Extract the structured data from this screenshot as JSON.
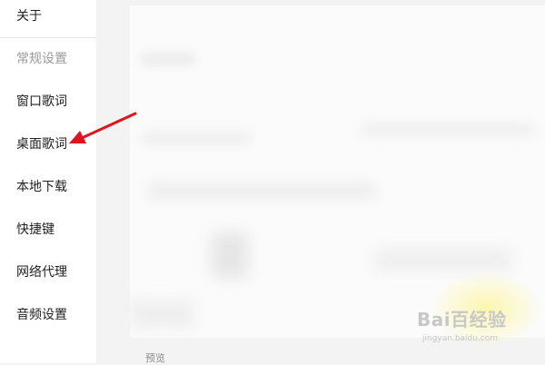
{
  "sidebar": {
    "items": [
      {
        "label": "关于"
      },
      {
        "label": "常规设置"
      },
      {
        "label": "窗口歌词"
      },
      {
        "label": "桌面歌词"
      },
      {
        "label": "本地下载"
      },
      {
        "label": "快捷键"
      },
      {
        "label": "网络代理"
      },
      {
        "label": "音频设置"
      }
    ]
  },
  "main": {
    "preview_label": "预览"
  },
  "watermark": {
    "brand": "Bai百经验",
    "url": "jingyan.baidu.com"
  },
  "colors": {
    "arrow": "#e0141e",
    "sidebar_bg": "#ffffff",
    "panel_bg": "#fbfbfb"
  }
}
